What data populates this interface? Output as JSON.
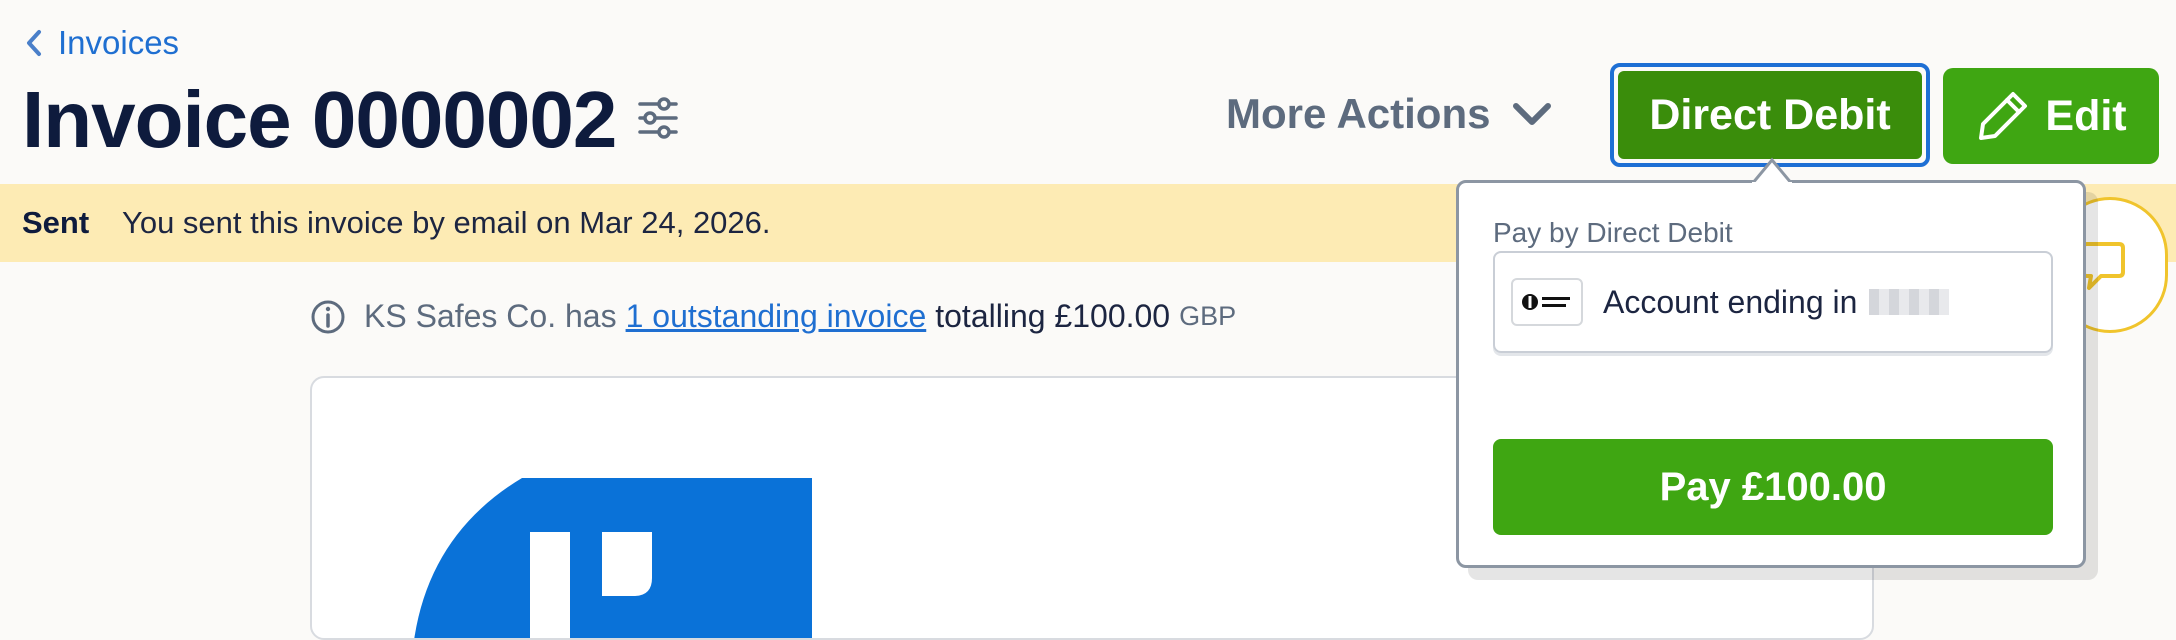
{
  "header": {
    "back_label": "Invoices",
    "title": "Invoice 0000002",
    "more_actions_label": "More Actions",
    "direct_debit_label": "Direct Debit",
    "edit_label": "Edit"
  },
  "banner": {
    "status": "Sent",
    "message": "You sent this invoice by email on Mar 24, 2026."
  },
  "info": {
    "prefix": "KS Safes Co. has",
    "link": "1 outstanding invoice",
    "middle": "totalling £100.00",
    "currency": "GBP"
  },
  "popover": {
    "title": "Pay by Direct Debit",
    "account_label": "Account ending in",
    "pay_label": "Pay £100.00"
  },
  "colors": {
    "primary_green": "#3fa612",
    "active_green": "#3a8d0b",
    "focus_blue": "#1e6fd4",
    "banner_yellow": "#fdebb4",
    "link_blue": "#1f6fd1",
    "logo_blue": "#0a72d8"
  },
  "icons": {
    "back": "chevron-left-icon",
    "filter": "sliders-icon",
    "more": "chevron-down-icon",
    "edit": "pencil-icon",
    "info": "info-circle-icon",
    "chat": "chat-bubble-icon",
    "direct_debit": "direct-debit-logo"
  }
}
